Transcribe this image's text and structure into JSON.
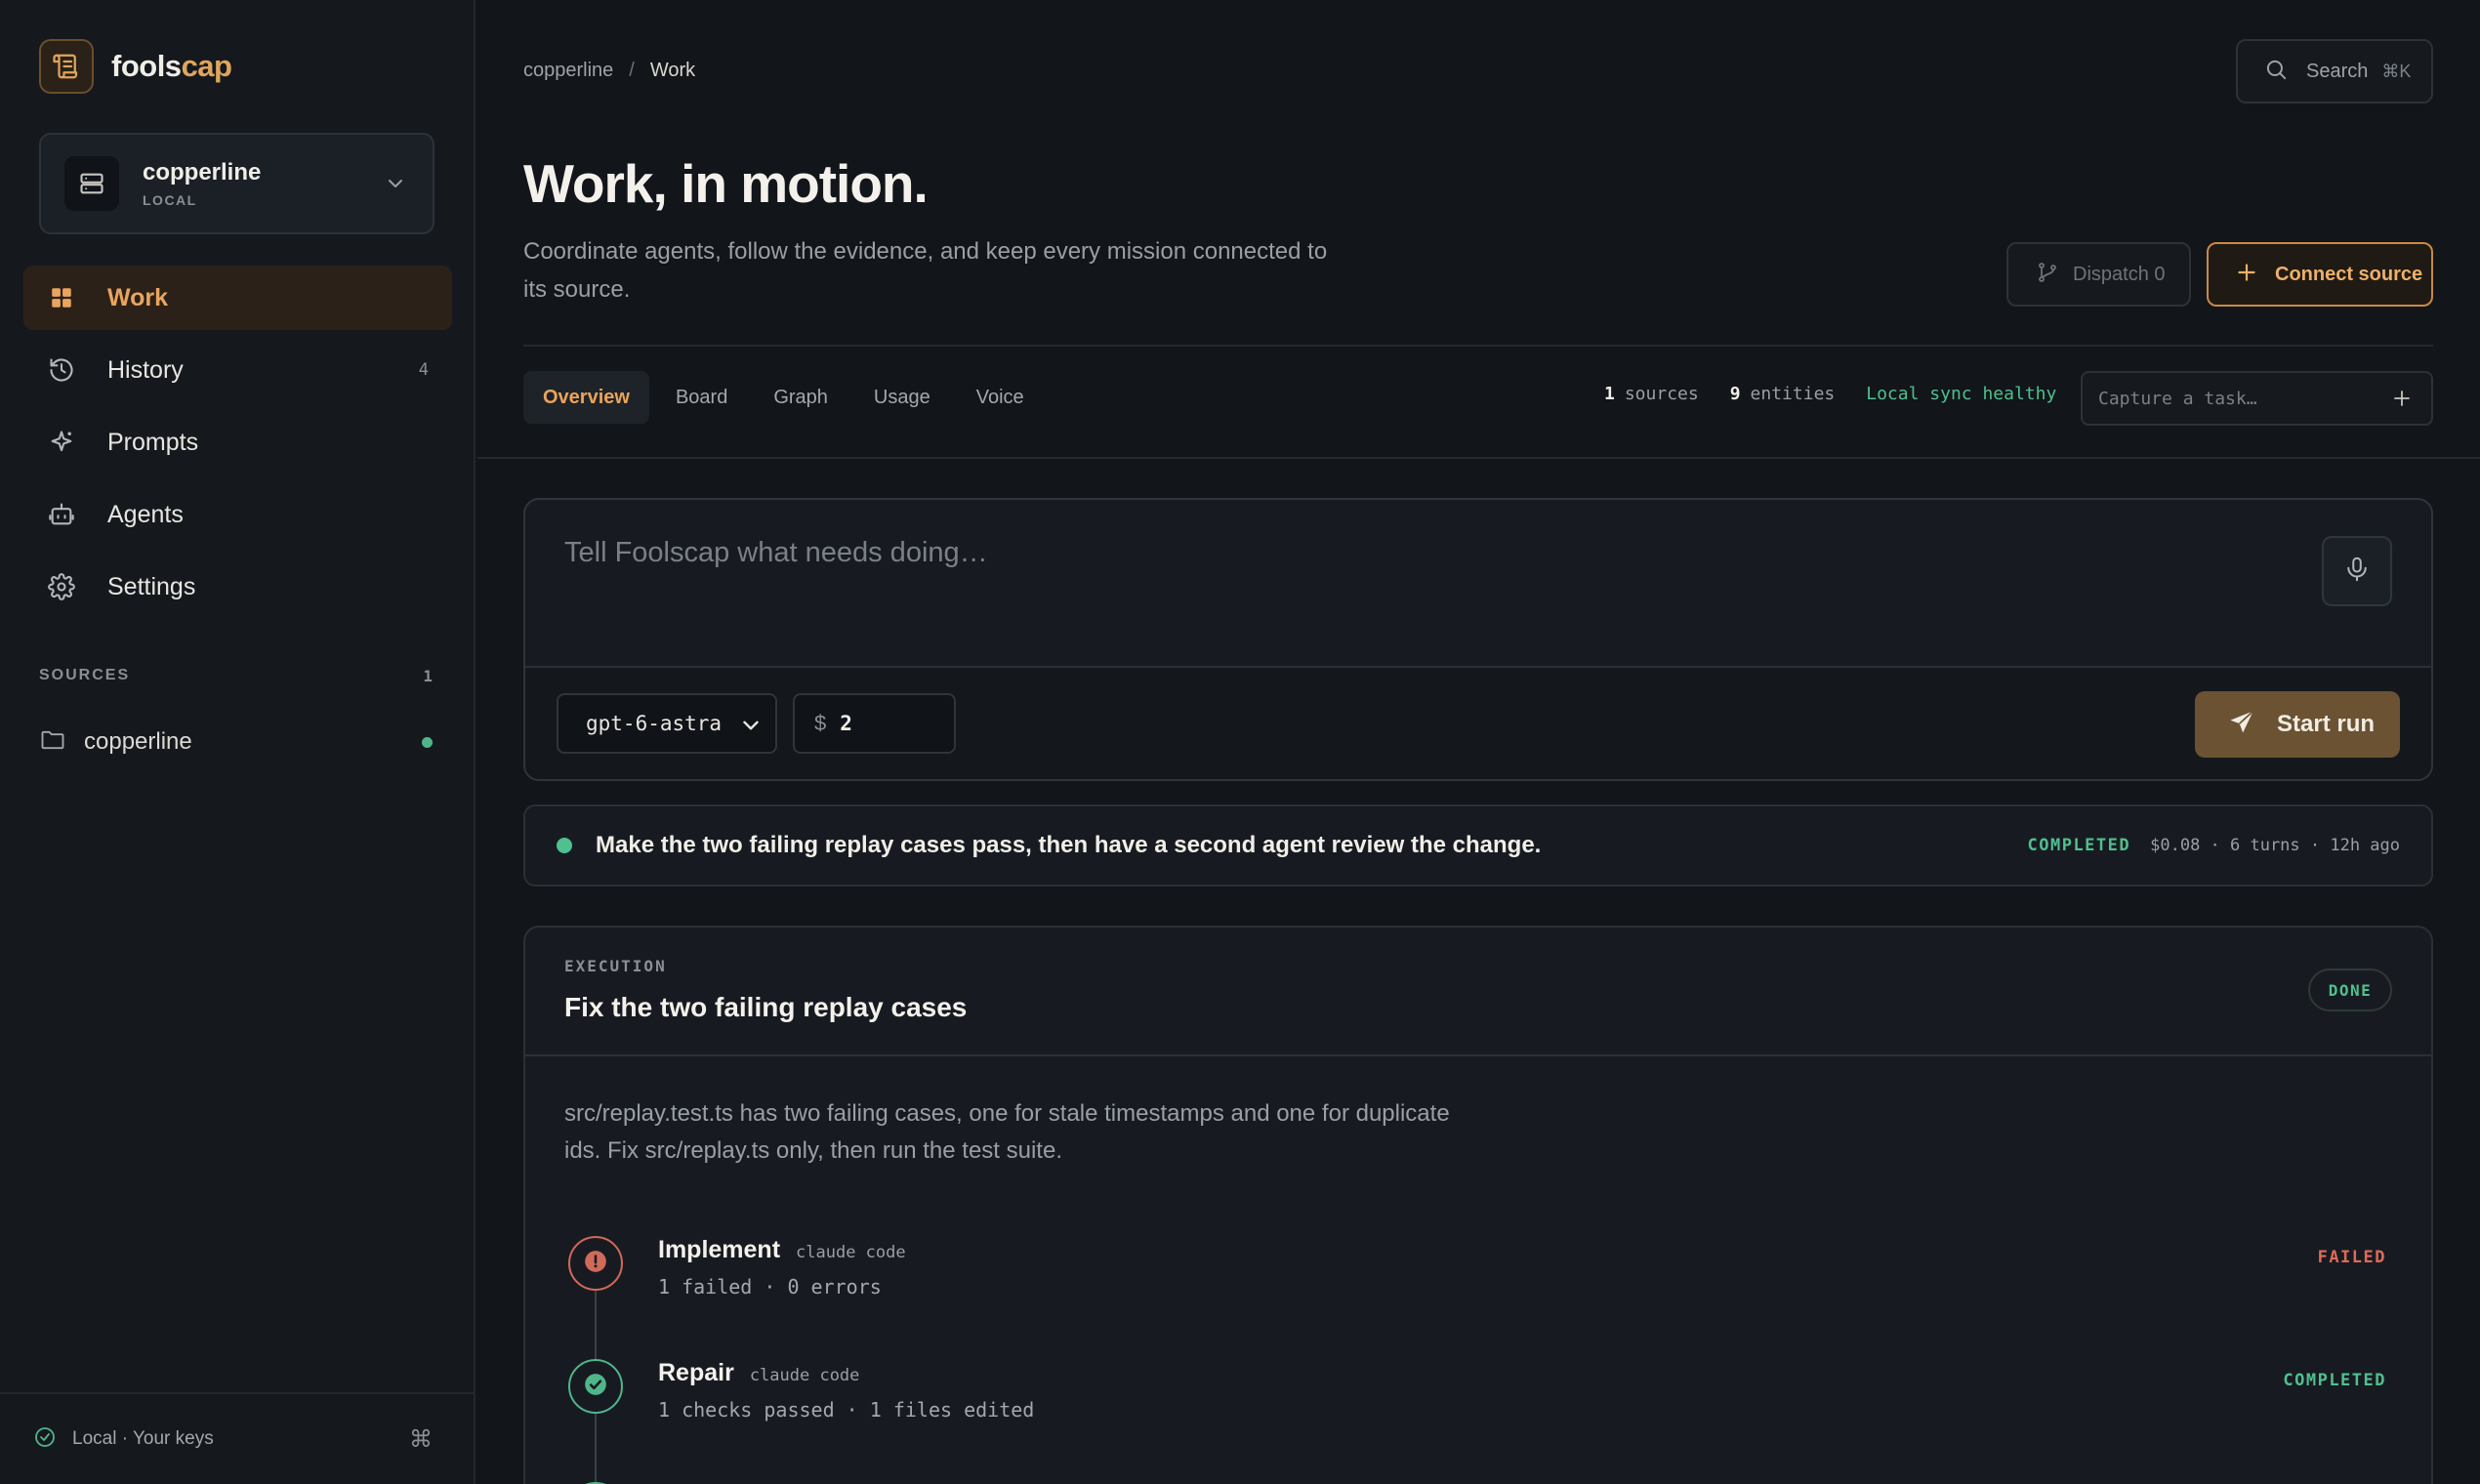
{
  "brand": {
    "name_part1": "fools",
    "name_part2": "cap"
  },
  "workspace": {
    "name": "copperline",
    "sub": "LOCAL"
  },
  "nav": [
    {
      "label": "Work",
      "icon": "grid-icon",
      "count": ""
    },
    {
      "label": "History",
      "icon": "history-icon",
      "count": "4"
    },
    {
      "label": "Prompts",
      "icon": "sparkle-icon",
      "count": ""
    },
    {
      "label": "Agents",
      "icon": "robot-icon",
      "count": ""
    },
    {
      "label": "Settings",
      "icon": "gear-icon",
      "count": ""
    }
  ],
  "sources": {
    "heading": "SOURCES",
    "count": "1",
    "items": [
      {
        "label": "copperline",
        "status_color": "#4fb68a"
      }
    ]
  },
  "footer": {
    "label": "Local · Your keys",
    "shortcut": "⌘"
  },
  "breadcrumb": {
    "root": "copperline",
    "sep": "/",
    "current": "Work"
  },
  "search": {
    "label": "Search",
    "shortcut": "⌘K"
  },
  "header": {
    "title": "Work, in motion.",
    "description": "Coordinate agents, follow the evidence, and keep every mission connected to its source.",
    "dispatch_label": "Dispatch 0",
    "connect_label": "Connect source"
  },
  "tabs": [
    "Overview",
    "Board",
    "Graph",
    "Usage",
    "Voice"
  ],
  "stats": {
    "sources_num": "1",
    "sources_label": "sources",
    "entities_num": "9",
    "entities_label": "entities",
    "sync": "Local sync healthy"
  },
  "capture": {
    "placeholder": "Capture a task…"
  },
  "composer": {
    "placeholder": "Tell Foolscap what needs doing…",
    "model": "gpt-6-astra",
    "budget_currency": "$",
    "budget_value": "2",
    "start_label": "Start run"
  },
  "run": {
    "text": "Make the two failing replay cases pass, then have a second agent review the change.",
    "status": "COMPLETED",
    "meta": "$0.08 · 6 turns · 12h ago"
  },
  "execution": {
    "eyebrow": "EXECUTION",
    "title": "Fix the two failing replay cases",
    "badge": "DONE",
    "description": "src/replay.test.ts has two failing cases, one for stale timestamps and one for duplicate ids. Fix src/replay.ts only, then run the test suite.",
    "steps": [
      {
        "name": "Implement",
        "agent": "claude code",
        "detail": "1 failed · 0 errors",
        "status": "FAILED"
      },
      {
        "name": "Repair",
        "agent": "claude code",
        "detail": "1 checks passed · 1 files edited",
        "status": "COMPLETED"
      }
    ]
  },
  "colors": {
    "accent": "#e9a55e",
    "success": "#4fc08f",
    "danger": "#e06b57",
    "background": "#121519"
  }
}
